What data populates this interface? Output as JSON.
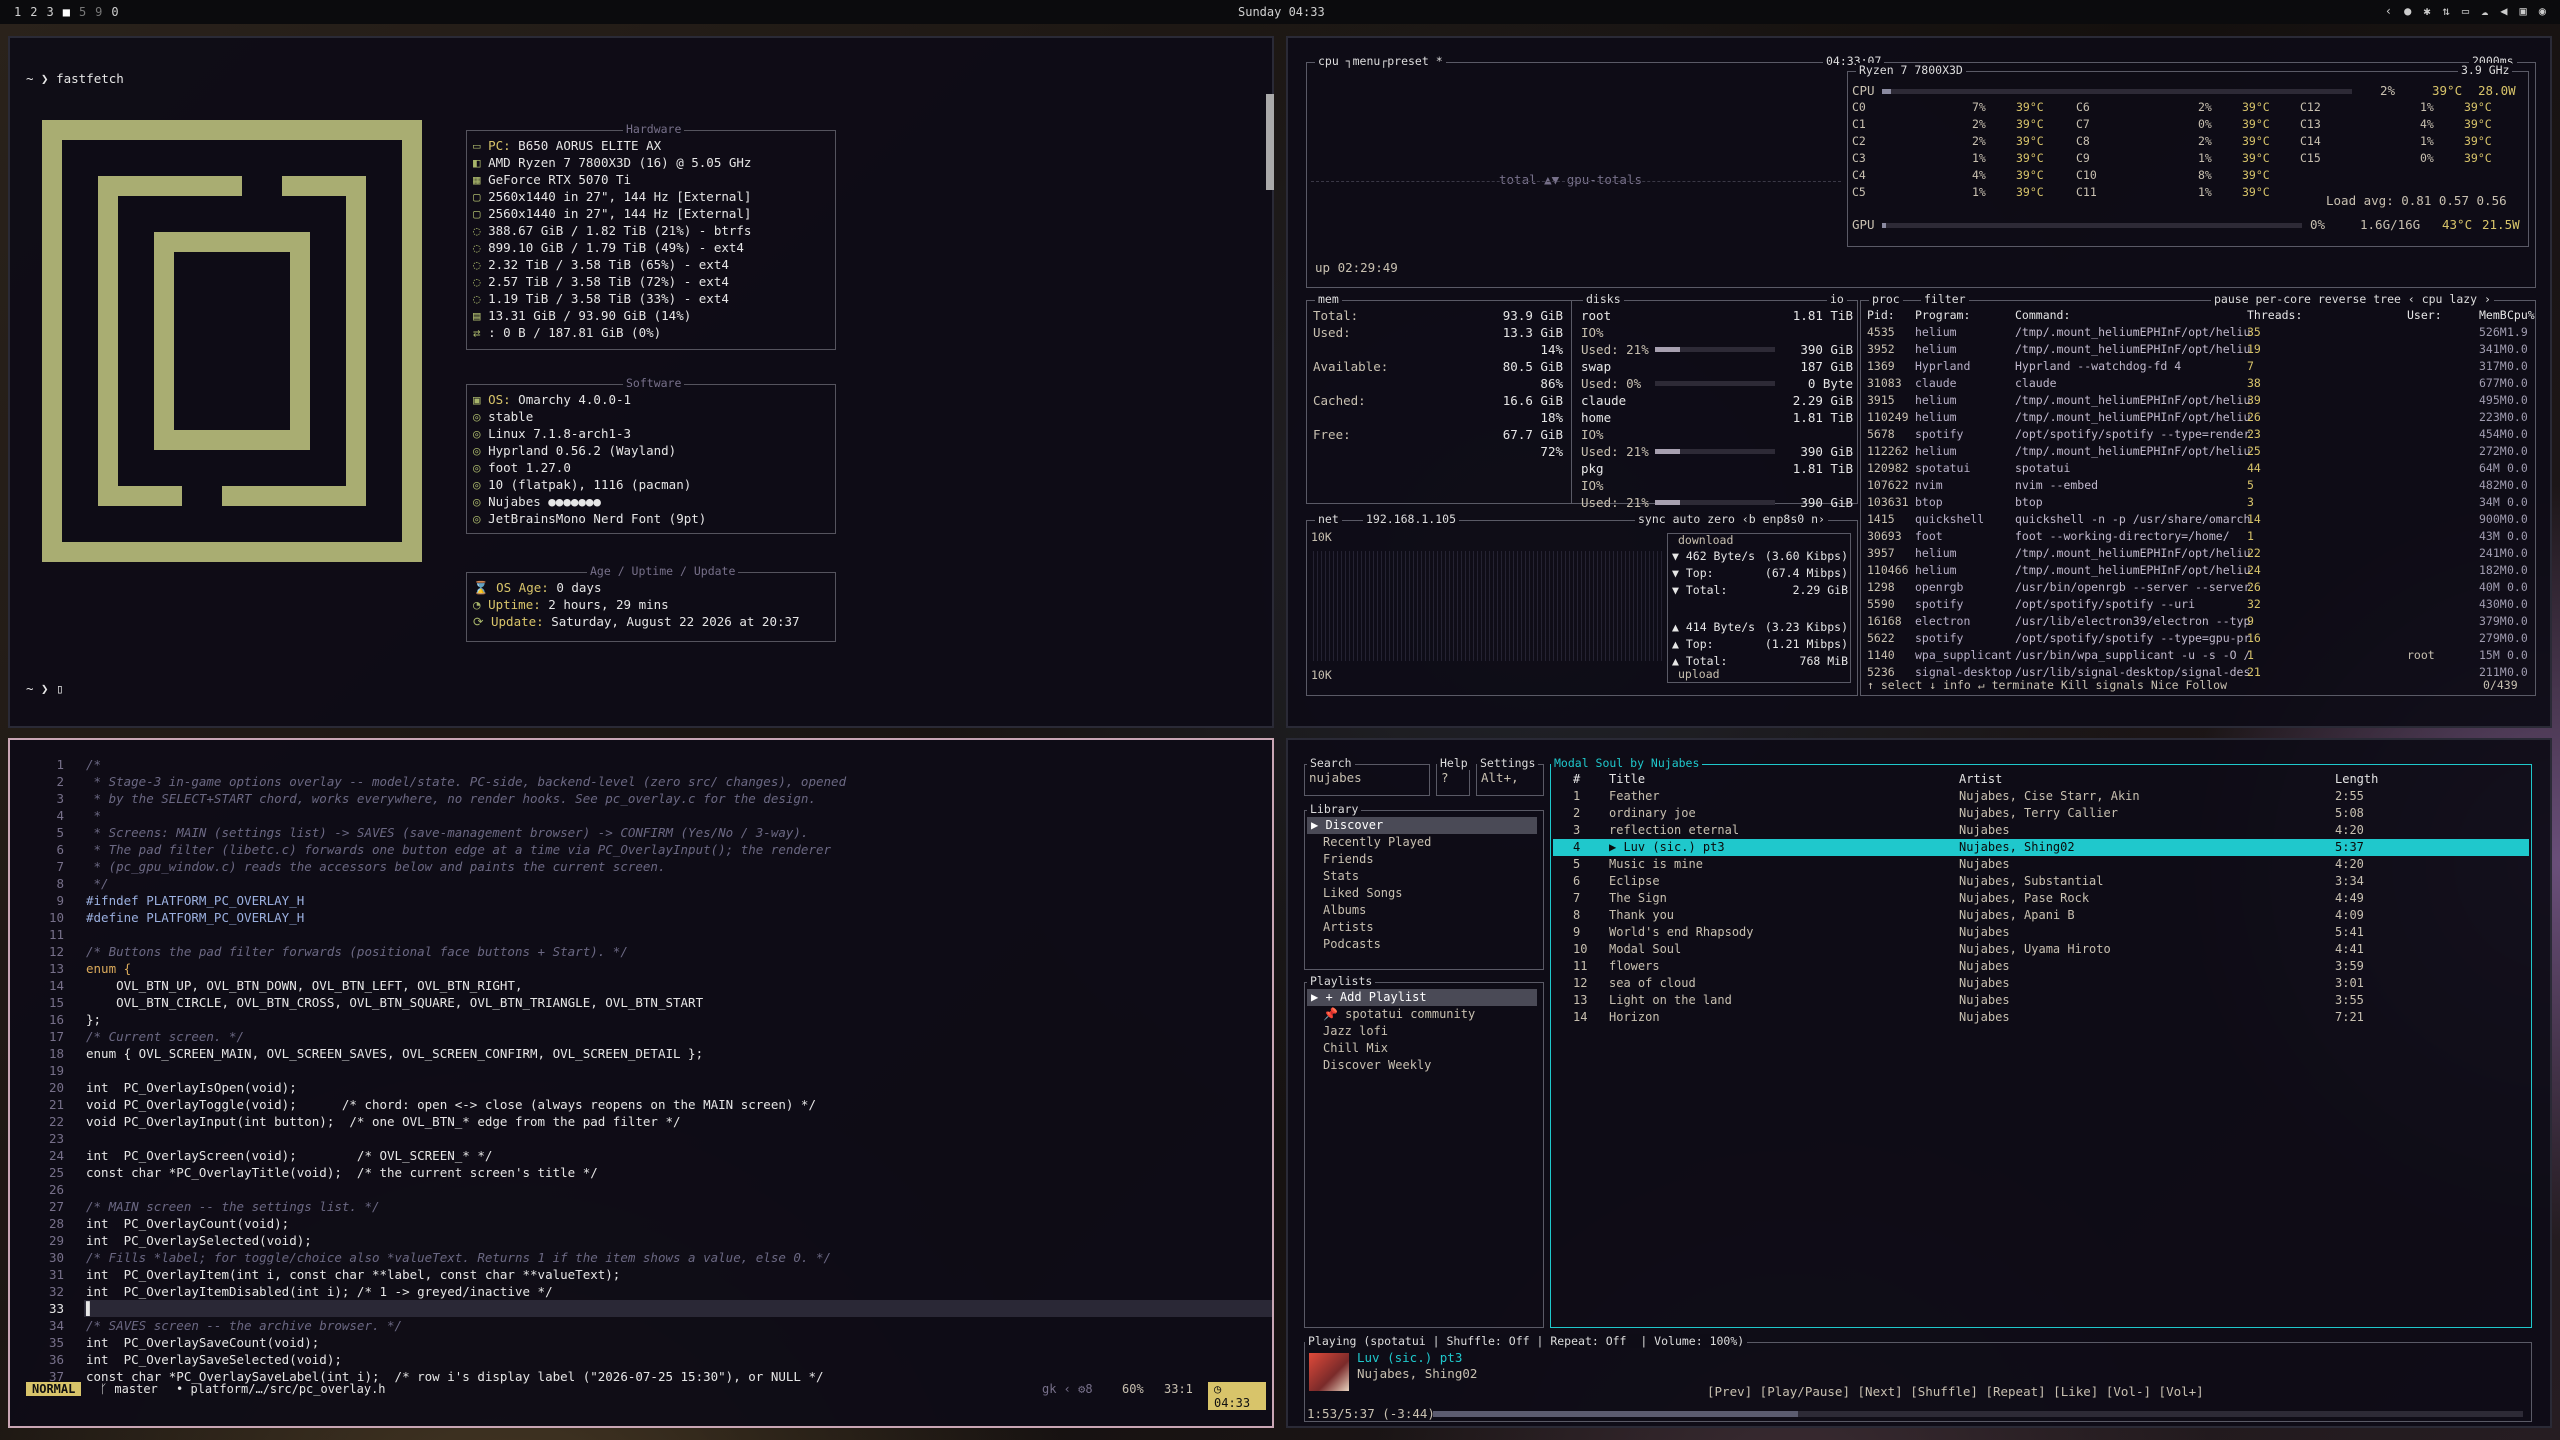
{
  "topbar": {
    "workspaces": [
      "1",
      "2",
      "3",
      "■",
      "5",
      "9",
      "0"
    ],
    "clock": "Sunday 04:33",
    "tray": [
      "‹",
      "●",
      "✱",
      "⇅",
      "▭",
      "☁",
      "◀",
      "▣",
      "◉"
    ]
  },
  "fastfetch": {
    "prompt": "~ ❯ fastfetch",
    "prompt2": "~ ❯ ▯",
    "hw_title": "Hardware",
    "hardware": [
      {
        "icon": "▭",
        "label": "PC: ",
        "value": "B650 AORUS ELITE AX"
      },
      {
        "icon": "◧",
        "label": "",
        "value": "AMD Ryzen 7 7800X3D (16) @ 5.05 GHz"
      },
      {
        "icon": "▦",
        "label": "",
        "value": "GeForce RTX 5070 Ti"
      },
      {
        "icon": "▢",
        "label": "",
        "value": "2560x1440 in 27\", 144 Hz [External]"
      },
      {
        "icon": "▢",
        "label": "",
        "value": "2560x1440 in 27\", 144 Hz [External]"
      },
      {
        "icon": "◌",
        "label": "",
        "value": "388.67 GiB / 1.82 TiB (21%) - btrfs"
      },
      {
        "icon": "◌",
        "label": "",
        "value": "899.10 GiB / 1.79 TiB (49%) - ext4"
      },
      {
        "icon": "◌",
        "label": "",
        "value": "2.32 TiB / 3.58 TiB (65%) - ext4"
      },
      {
        "icon": "◌",
        "label": "",
        "value": "2.57 TiB / 3.58 TiB (72%) - ext4"
      },
      {
        "icon": "◌",
        "label": "",
        "value": "1.19 TiB / 3.58 TiB (33%) - ext4"
      },
      {
        "icon": "▤",
        "label": "",
        "value": "13.31 GiB / 93.90 GiB (14%)"
      },
      {
        "icon": "⇄",
        "label": "",
        "value": ": 0 B / 187.81 GiB (0%)"
      }
    ],
    "sw_title": "Software",
    "software": [
      {
        "icon": "▣",
        "label": "OS: ",
        "value": "Omarchy 4.0.0-1"
      },
      {
        "icon": "◎",
        "label": "",
        "value": "stable"
      },
      {
        "icon": "◎",
        "label": "",
        "value": "Linux 7.1.8-arch1-3"
      },
      {
        "icon": "◎",
        "label": "",
        "value": "Hyprland 0.56.2 (Wayland)"
      },
      {
        "icon": "◎",
        "label": "",
        "value": "foot 1.27.0"
      },
      {
        "icon": "◎",
        "label": "",
        "value": "10 (flatpak), 1116 (pacman)"
      },
      {
        "icon": "◎",
        "label": "",
        "value": "Nujabes ●●●●●●●"
      },
      {
        "icon": "◎",
        "label": "",
        "value": "JetBrainsMono Nerd Font (9pt)"
      }
    ],
    "age_title": "Age / Uptime / Update",
    "age": [
      {
        "icon": "⌛",
        "label": "OS Age: ",
        "value": "0 days"
      },
      {
        "icon": "◔",
        "label": "Uptime: ",
        "value": "2 hours, 29 mins"
      },
      {
        "icon": "⟳",
        "label": "Update: ",
        "value": "Saturday, August 22 2026 at 20:37"
      }
    ]
  },
  "btop": {
    "cpu_tabs": "cpu ┐menu┌preset *",
    "clock": "04:33:07",
    "refresh": "2000ms",
    "cpu_name": "Ryzen 7 7800X3D",
    "freq": "3.9 GHz",
    "cpu_total": {
      "label": "CPU",
      "pct": "2%",
      "temp": "39°C",
      "power": "28.0W",
      "fill": 0.02
    },
    "cores": [
      [
        "C0",
        "7%",
        "39°C",
        "C6",
        "2%",
        "39°C",
        "C12",
        "1%",
        "39°C"
      ],
      [
        "C1",
        "2%",
        "39°C",
        "C7",
        "0%",
        "39°C",
        "C13",
        "4%",
        "39°C"
      ],
      [
        "C2",
        "2%",
        "39°C",
        "C8",
        "2%",
        "39°C",
        "C14",
        "1%",
        "39°C"
      ],
      [
        "C3",
        "1%",
        "39°C",
        "C9",
        "1%",
        "39°C",
        "C15",
        "0%",
        "39°C"
      ],
      [
        "C4",
        "4%",
        "39°C",
        "C10",
        "8%",
        "39°C",
        "",
        "",
        " "
      ],
      [
        "C5",
        "1%",
        "39°C",
        "C11",
        "1%",
        "39°C",
        "",
        "",
        " "
      ]
    ],
    "load": "Load avg: 0.81 0.57 0.56",
    "gpu": {
      "label": "GPU",
      "pct": "0%",
      "mem": "1.6G/16G",
      "temp": "43°C",
      "power": "21.5W"
    },
    "totals": "total ▲▼ gpu-totals",
    "uptime": "up 02:29:49",
    "mem": {
      "title": "mem",
      "rows": [
        [
          "Total:",
          "93.9 GiB"
        ],
        [
          "Used:",
          "13.3 GiB"
        ],
        [
          "",
          "14%"
        ],
        [
          "Available:",
          "80.5 GiB"
        ],
        [
          "",
          "86%"
        ],
        [
          "Cached:",
          "16.6 GiB"
        ],
        [
          "",
          "18%"
        ],
        [
          "Free:",
          "67.7 GiB"
        ],
        [
          "",
          "72%"
        ]
      ]
    },
    "disks": {
      "title": "disks",
      "io": "io",
      "rows": [
        [
          "root",
          "1.81 TiB"
        ],
        [
          "IO%",
          ""
        ],
        [
          "Used: 21%",
          "390 GiB"
        ],
        [
          "swap",
          "187 GiB"
        ],
        [
          "Used: 0%",
          "0 Byte"
        ],
        [
          "claude",
          "2.29 GiB"
        ],
        [
          "home",
          "1.81 TiB"
        ],
        [
          "IO%",
          ""
        ],
        [
          "Used: 21%",
          "390 GiB"
        ],
        [
          "pkg",
          "1.81 TiB"
        ],
        [
          "IO%",
          ""
        ],
        [
          "Used: 21%",
          "390 GiB"
        ]
      ]
    },
    "net": {
      "title": "net",
      "ip": "192.168.1.105",
      "tabs": "sync auto zero ‹b enp8s0 n›",
      "scale_top": "10K",
      "scale_bot": "10K",
      "download": "download",
      "up_label": "upload",
      "rows": [
        [
          "▼ 462 Byte/s",
          "(3.60 Kibps)"
        ],
        [
          "▼ Top:",
          "(67.4 Mibps)"
        ],
        [
          "▼ Total:",
          "2.29 GiB"
        ],
        [
          "▲ 414 Byte/s",
          "(3.23 Kibps)"
        ],
        [
          "▲ Top:",
          "(1.21 Mibps)"
        ],
        [
          "▲ Total:",
          "768 MiB"
        ]
      ]
    },
    "proc": {
      "title": "proc",
      "filter": "filter",
      "tabs": "pause per-core reverse tree ‹ cpu lazy ›",
      "count": "0/439",
      "header": [
        "Pid:",
        "Program:",
        "Command:",
        "Threads:",
        "User:",
        "MemB",
        "Cpu%"
      ],
      "rows": [
        [
          "4535",
          "helium",
          "/tmp/.mount_heliumEPHInF/opt/heliu",
          "35",
          "",
          "526M",
          "1.9"
        ],
        [
          "3952",
          "helium",
          "/tmp/.mount_heliumEPHInF/opt/heliu",
          "19",
          "",
          "341M",
          "0.0"
        ],
        [
          "1369",
          "Hyprland",
          "Hyprland --watchdog-fd 4",
          "7",
          "",
          "317M",
          "0.0"
        ],
        [
          "31083",
          "claude",
          "claude",
          "38",
          "",
          "677M",
          "0.0"
        ],
        [
          "3915",
          "helium",
          "/tmp/.mount_heliumEPHInF/opt/heliu",
          "39",
          "",
          "495M",
          "0.0"
        ],
        [
          "110249",
          "helium",
          "/tmp/.mount_heliumEPHInF/opt/heliu",
          "26",
          "",
          "223M",
          "0.0"
        ],
        [
          "5678",
          "spotify",
          "/opt/spotify/spotify --type=render",
          "23",
          "",
          "454M",
          "0.0"
        ],
        [
          "112262",
          "helium",
          "/tmp/.mount_heliumEPHInF/opt/heliu",
          "25",
          "",
          "272M",
          "0.0"
        ],
        [
          "120982",
          "spotatui",
          "spotatui",
          "44",
          "",
          "64M",
          "0.0"
        ],
        [
          "107622",
          "nvim",
          "nvim --embed",
          "5",
          "",
          "482M",
          "0.0"
        ],
        [
          "103631",
          "btop",
          "btop",
          "3",
          "",
          "34M",
          "0.0"
        ],
        [
          "1415",
          "quickshell",
          "quickshell -n -p /usr/share/omarch",
          "14",
          "",
          "900M",
          "0.0"
        ],
        [
          "30693",
          "foot",
          "foot --working-directory=/home/",
          "1",
          "",
          "43M",
          "0.0"
        ],
        [
          "3957",
          "helium",
          "/tmp/.mount_heliumEPHInF/opt/heliu",
          "22",
          "",
          "241M",
          "0.0"
        ],
        [
          "110466",
          "helium",
          "/tmp/.mount_heliumEPHInF/opt/heliu",
          "24",
          "",
          "182M",
          "0.0"
        ],
        [
          "1298",
          "openrgb",
          "/usr/bin/openrgb --server --server",
          "26",
          "",
          "40M",
          "0.0"
        ],
        [
          "5590",
          "spotify",
          "/opt/spotify/spotify --uri",
          "32",
          "",
          "430M",
          "0.0"
        ],
        [
          "16168",
          "electron",
          "/usr/lib/electron39/electron --typ",
          "9",
          "",
          "379M",
          "0.0"
        ],
        [
          "5622",
          "spotify",
          "/opt/spotify/spotify --type=gpu-pr",
          "16",
          "",
          "279M",
          "0.0"
        ],
        [
          "1140",
          "wpa_supplicant",
          "/usr/bin/wpa_supplicant -u -s -O /",
          "1",
          "root",
          "15M",
          "0.0"
        ],
        [
          "5236",
          "signal-desktop",
          "/usr/lib/signal-desktop/signal-des",
          "21",
          "",
          "211M",
          "0.0"
        ]
      ],
      "footer": "↑ select ↓ info ↵ terminate Kill signals Nice Follow"
    }
  },
  "nvim": {
    "lines": [
      {
        "n": "1",
        "t": "/*",
        "c": "cmt"
      },
      {
        "n": "2",
        "t": " * Stage-3 in-game options overlay -- model/state. PC-side, backend-level (zero src/ changes), opened",
        "c": "cmt"
      },
      {
        "n": "3",
        "t": " * by the SELECT+START chord, works everywhere, no render hooks. See pc_overlay.c for the design.",
        "c": "cmt"
      },
      {
        "n": "4",
        "t": " *",
        "c": "cmt"
      },
      {
        "n": "5",
        "t": " * Screens: MAIN (settings list) -> SAVES (save-management browser) -> CONFIRM (Yes/No / 3-way).",
        "c": "cmt"
      },
      {
        "n": "6",
        "t": " * The pad filter (libetc.c) forwards one button edge at a time via PC_OverlayInput(); the renderer",
        "c": "cmt"
      },
      {
        "n": "7",
        "t": " * (pc_gpu_window.c) reads the accessors below and paints the current screen.",
        "c": "cmt"
      },
      {
        "n": "8",
        "t": " */",
        "c": "cmt"
      },
      {
        "n": "9",
        "t": "#ifndef PLATFORM_PC_OVERLAY_H",
        "c": "mac"
      },
      {
        "n": "10",
        "t": "#define PLATFORM_PC_OVERLAY_H",
        "c": "mac"
      },
      {
        "n": "11",
        "t": "",
        "c": ""
      },
      {
        "n": "12",
        "t": "/* Buttons the pad filter forwards (positional face buttons + Start). */",
        "c": "cmt"
      },
      {
        "n": "13",
        "t": "enum {",
        "c": "kw"
      },
      {
        "n": "14",
        "t": "    OVL_BTN_UP, OVL_BTN_DOWN, OVL_BTN_LEFT, OVL_BTN_RIGHT,",
        "c": "white"
      },
      {
        "n": "15",
        "t": "    OVL_BTN_CIRCLE, OVL_BTN_CROSS, OVL_BTN_SQUARE, OVL_BTN_TRIANGLE, OVL_BTN_START",
        "c": "white"
      },
      {
        "n": "16",
        "t": "};",
        "c": "white"
      },
      {
        "n": "17",
        "t": "/* Current screen. */",
        "c": "cmt"
      },
      {
        "n": "18",
        "t": "enum { OVL_SCREEN_MAIN, OVL_SCREEN_SAVES, OVL_SCREEN_CONFIRM, OVL_SCREEN_DETAIL };",
        "c": "white"
      },
      {
        "n": "19",
        "t": "",
        "c": ""
      },
      {
        "n": "20",
        "t": "int  PC_OverlayIsOpen(void);",
        "c": "white"
      },
      {
        "n": "21",
        "t": "void PC_OverlayToggle(void);      /* chord: open <-> close (always reopens on the MAIN screen) */",
        "c": "white"
      },
      {
        "n": "22",
        "t": "void PC_OverlayInput(int button);  /* one OVL_BTN_* edge from the pad filter */",
        "c": "white"
      },
      {
        "n": "23",
        "t": "",
        "c": ""
      },
      {
        "n": "24",
        "t": "int  PC_OverlayScreen(void);        /* OVL_SCREEN_* */",
        "c": "white"
      },
      {
        "n": "25",
        "t": "const char *PC_OverlayTitle(void);  /* the current screen's title */",
        "c": "white"
      },
      {
        "n": "26",
        "t": "",
        "c": ""
      },
      {
        "n": "27",
        "t": "/* MAIN screen -- the settings list. */",
        "c": "cmt"
      },
      {
        "n": "28",
        "t": "int  PC_OverlayCount(void);",
        "c": "white"
      },
      {
        "n": "29",
        "t": "int  PC_OverlaySelected(void);",
        "c": "white"
      },
      {
        "n": "30",
        "t": "/* Fills *label; for toggle/choice also *valueText. Returns 1 if the item shows a value, else 0. */",
        "c": "cmt"
      },
      {
        "n": "31",
        "t": "int  PC_OverlayItem(int i, const char **label, const char **valueText);",
        "c": "white"
      },
      {
        "n": "32",
        "t": "int  PC_OverlayItemDisabled(int i); /* 1 -> greyed/inactive */",
        "c": "white"
      },
      {
        "n": "33",
        "t": "▌",
        "c": "white"
      },
      {
        "n": "34",
        "t": "/* SAVES screen -- the archive browser. */",
        "c": "cmt"
      },
      {
        "n": "35",
        "t": "int  PC_OverlaySaveCount(void);",
        "c": "white"
      },
      {
        "n": "36",
        "t": "int  PC_OverlaySaveSelected(void);",
        "c": "white"
      },
      {
        "n": "37",
        "t": "const char *PC_OverlaySaveLabel(int i);  /* row i's display label (\"2026-07-25 15:30\"), or NULL */",
        "c": "white"
      }
    ],
    "status": {
      "mode": "NORMAL",
      "branch": "ᚴ master",
      "file": "•  platform/…/src/pc_overlay.h",
      "right": "gk ‹ ⚙8",
      "pct": "60%",
      "pos": "33:1",
      "time": "◷ 04:33"
    }
  },
  "spot": {
    "search_label": "Search",
    "search_value": "nujabes",
    "help_label": "Help",
    "help_value": "?",
    "settings_label": "Settings",
    "settings_value": "Alt+,",
    "library_label": "Library",
    "library": [
      "▶ Discover",
      "Recently Played",
      "Friends",
      "Stats",
      "Liked Songs",
      "Albums",
      "Artists",
      "Podcasts"
    ],
    "playlists_label": "Playlists",
    "playlists": [
      "▶ + Add Playlist",
      "📌 spotatui community",
      "Jazz lofi",
      "Chill Mix",
      "Discover Weekly"
    ],
    "album_title": "Modal Soul by Nujabes",
    "header": [
      "#",
      "Title",
      "Artist",
      "Length"
    ],
    "tracks": [
      [
        "1",
        "Feather",
        "Nujabes, Cise Starr, Akin",
        "2:55"
      ],
      [
        "2",
        "ordinary joe",
        "Nujabes, Terry Callier",
        "5:08"
      ],
      [
        "3",
        "reflection eternal",
        "Nujabes",
        "4:20"
      ],
      [
        "4",
        "▶ Luv (sic.) pt3",
        "Nujabes, Shing02",
        "5:37"
      ],
      [
        "5",
        "Music is mine",
        "Nujabes",
        "4:20"
      ],
      [
        "6",
        "Eclipse",
        "Nujabes, Substantial",
        "3:34"
      ],
      [
        "7",
        "The Sign",
        "Nujabes, Pase Rock",
        "4:49"
      ],
      [
        "8",
        "Thank you",
        "Nujabes, Apani B",
        "4:09"
      ],
      [
        "9",
        "World's end Rhapsody",
        "Nujabes",
        "5:41"
      ],
      [
        "10",
        "Modal Soul",
        "Nujabes, Uyama Hiroto",
        "4:41"
      ],
      [
        "11",
        "flowers",
        "Nujabes",
        "3:59"
      ],
      [
        "12",
        "sea of cloud",
        "Nujabes",
        "3:01"
      ],
      [
        "13",
        "Light on the land",
        "Nujabes",
        "3:55"
      ],
      [
        "14",
        "Horizon",
        "Nujabes",
        "7:21"
      ]
    ],
    "playing_label": "Playing (spotatui | Shuffle: Off | Repeat: Off  | Volume: 100%)",
    "now_title": "Luv (sic.) pt3",
    "now_artist": "Nujabes, Shing02",
    "controls": "[Prev] [Play/Pause] [Next] [Shuffle] [Repeat] [Like] [Vol-] [Vol+]",
    "progress_text": "1:53/5:37 (-3:44)",
    "progress": 0.335,
    "colors": {
      "accent": "#1fc8cc",
      "album_title": "#1fc8cc"
    }
  }
}
